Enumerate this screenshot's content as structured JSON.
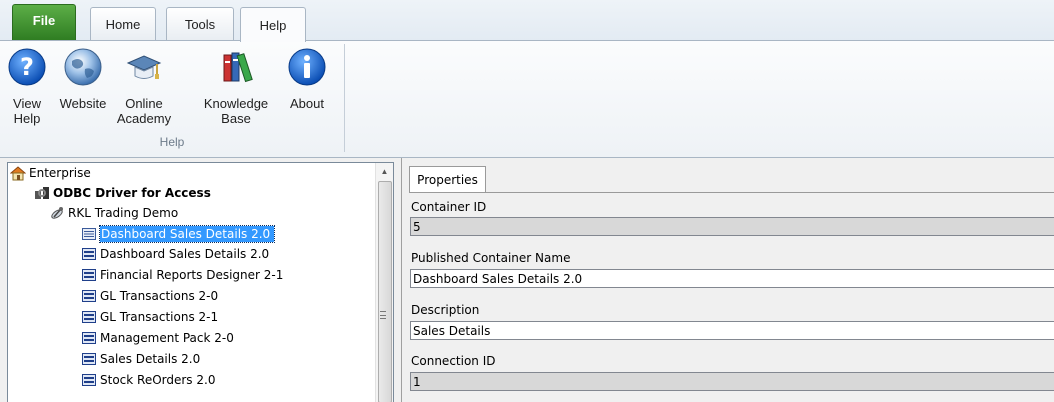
{
  "ribbon": {
    "tabs": [
      {
        "label": "File"
      },
      {
        "label": "Home"
      },
      {
        "label": "Tools"
      },
      {
        "label": "Help"
      }
    ],
    "buttons": [
      {
        "label1": "View",
        "label2": "Help",
        "icon": "help-circle-icon"
      },
      {
        "label1": "Website",
        "label2": "",
        "icon": "globe-icon"
      },
      {
        "label1": "Online",
        "label2": "Academy",
        "icon": "graduation-cap-icon"
      },
      {
        "label1": "Knowledge",
        "label2": "Base",
        "icon": "books-icon"
      },
      {
        "label1": "About",
        "label2": "",
        "icon": "info-icon"
      }
    ],
    "group_label": "Help"
  },
  "tree": {
    "items": [
      {
        "label": "Enterprise",
        "icon": "home-icon",
        "level": 0
      },
      {
        "label": "ODBC Driver for Access",
        "icon": "odbc-driver-icon",
        "level": 1
      },
      {
        "label": "RKL Trading Demo",
        "icon": "satellite-icon",
        "level": 2
      },
      {
        "label": "Dashboard Sales Details 2.0",
        "icon": "container-icon",
        "level": 3,
        "selected": true
      },
      {
        "label": "Dashboard Sales Details 2.0",
        "icon": "container-icon",
        "level": 3
      },
      {
        "label": "Financial Reports Designer 2-1",
        "icon": "container-icon",
        "level": 3
      },
      {
        "label": "GL Transactions 2-0",
        "icon": "container-icon",
        "level": 3
      },
      {
        "label": "GL Transactions 2-1",
        "icon": "container-icon",
        "level": 3
      },
      {
        "label": "Management Pack 2-0",
        "icon": "container-icon",
        "level": 3
      },
      {
        "label": "Sales Details 2.0",
        "icon": "container-icon",
        "level": 3
      },
      {
        "label": "Stock ReOrders 2.0",
        "icon": "container-icon",
        "level": 3
      }
    ]
  },
  "properties": {
    "tab_label": "Properties",
    "fields": [
      {
        "label": "Container ID",
        "value": "5",
        "readonly": true
      },
      {
        "label": "Published Container Name",
        "value": "Dashboard Sales Details 2.0",
        "readonly": false
      },
      {
        "label": "Description",
        "value": "Sales Details",
        "readonly": false
      },
      {
        "label": "Connection ID",
        "value": "1",
        "readonly": true
      }
    ]
  },
  "colors": {
    "file_tab": "#3f8f2e",
    "selection": "#3399ff",
    "readonly_field": "#d8d8d8"
  }
}
